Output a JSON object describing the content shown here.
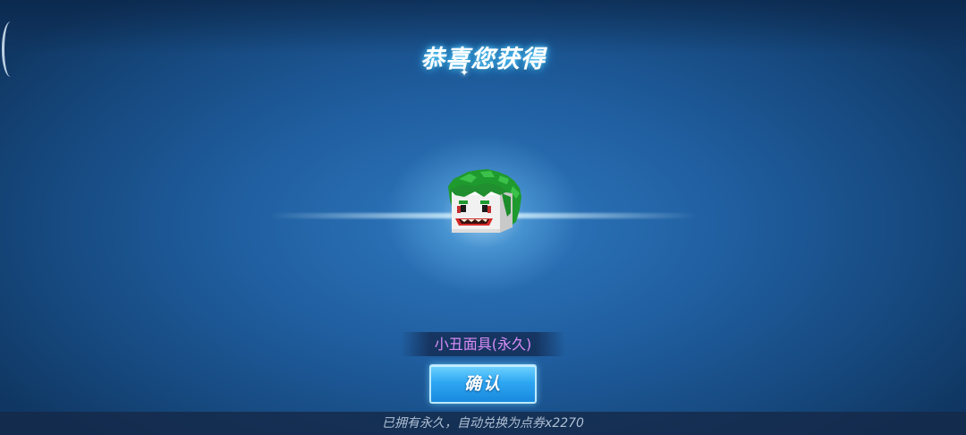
{
  "title": "恭喜您获得",
  "reward": {
    "item_name": "小丑面具(永久)",
    "icon": "joker-mask-icon",
    "name_color": "#d88cf5"
  },
  "confirm_label": "确认",
  "footer_note": "已拥有永久，自动兑换为点券x2270",
  "colors": {
    "background": "#1f5d9e",
    "button": "#2ea7f2"
  }
}
